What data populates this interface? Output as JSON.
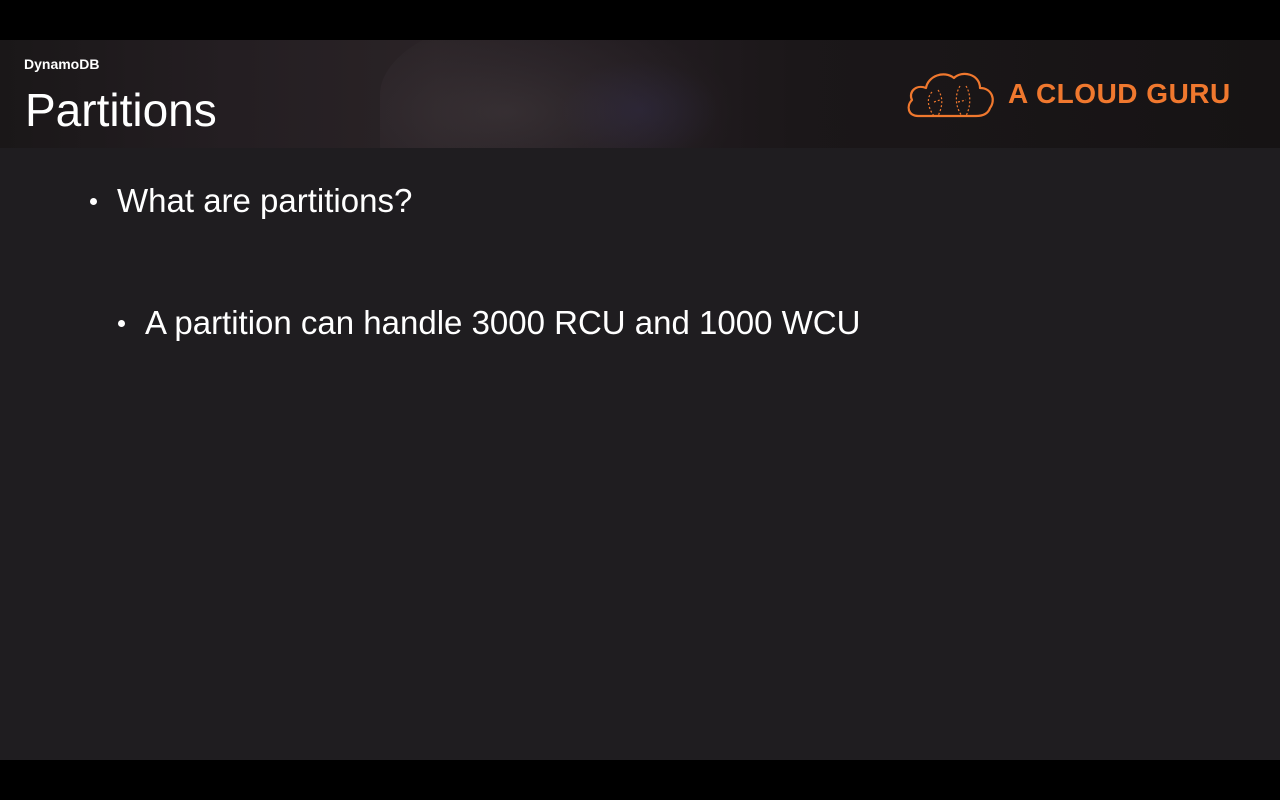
{
  "header": {
    "section": "DynamoDB",
    "title": "Partitions",
    "brand": {
      "name": "A CLOUD GURU",
      "icon": "cloud-icon",
      "color": "#f0782e"
    }
  },
  "bullets": [
    {
      "level": 1,
      "text": "What are partitions?"
    },
    {
      "level": 2,
      "text": "A partition can handle 3000 RCU and 1000 WCU"
    }
  ],
  "colors": {
    "background": "#1f1d20",
    "text": "#ffffff",
    "accent": "#f0782e"
  }
}
